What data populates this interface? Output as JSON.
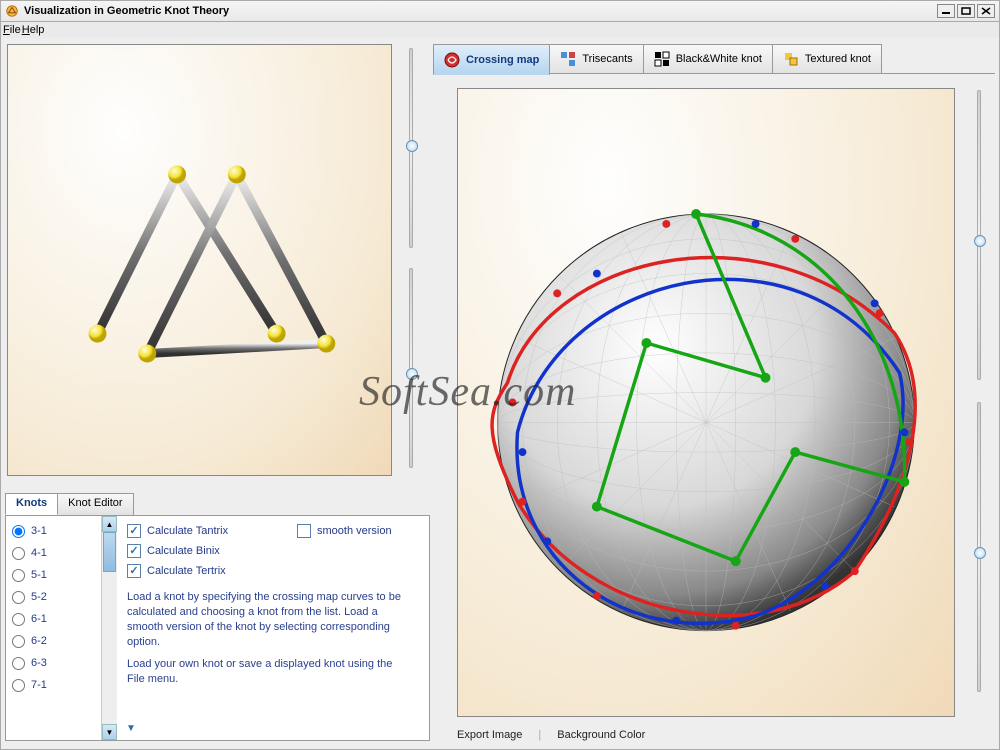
{
  "window": {
    "title": "Visualization in Geometric Knot Theory"
  },
  "menu": {
    "file": "File",
    "help": "Help"
  },
  "knotpanel": {
    "tabs": {
      "knots": "Knots",
      "editor": "Knot Editor"
    },
    "list": [
      "3-1",
      "4-1",
      "5-1",
      "5-2",
      "6-1",
      "6-2",
      "6-3",
      "7-1"
    ],
    "selected": "3-1",
    "options": {
      "tantrix": "Calculate Tantrix",
      "binix": "Calculate Binix",
      "tertrix": "Calculate Tertrix",
      "smooth": "smooth version"
    },
    "help1": "Load a knot by specifying the crossing map curves to be calculated and choosing a knot from the list. Load a smooth version of the knot by selecting corresponding option.",
    "help2": "Load your own knot or save a displayed knot using the File menu."
  },
  "right": {
    "tabs": {
      "crossing": "Crossing map",
      "trisecants": "Trisecants",
      "bw": "Black&White knot",
      "textured": "Textured knot"
    },
    "bottom": {
      "export": "Export Image",
      "bgcolor": "Background Color"
    }
  },
  "watermark": "SoftSea.com"
}
